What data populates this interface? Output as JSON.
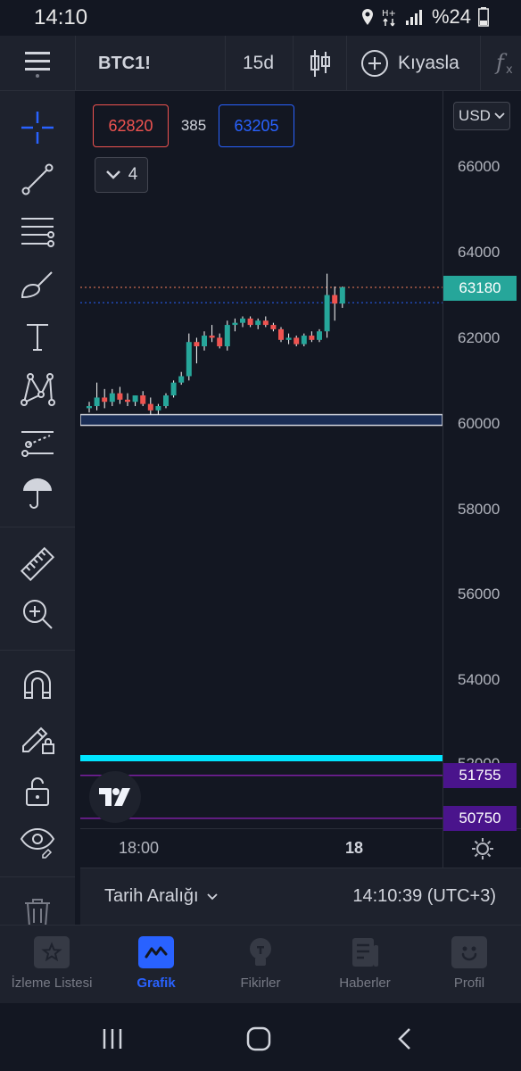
{
  "status_bar": {
    "time": "14:10",
    "battery": "%24"
  },
  "toolbar": {
    "symbol": "BTC1!",
    "interval": "15d",
    "compare_label": "Kıyasla"
  },
  "left_tools": [
    {
      "name": "crosshair-icon"
    },
    {
      "name": "trend-line-icon"
    },
    {
      "name": "fib-retracement-icon"
    },
    {
      "name": "brush-icon"
    },
    {
      "name": "text-tool-icon"
    },
    {
      "name": "pattern-icon"
    },
    {
      "name": "prediction-icon"
    },
    {
      "name": "long-position-icon"
    },
    {
      "name": "ruler-icon"
    },
    {
      "name": "zoom-in-icon"
    },
    {
      "name": "magnet-icon"
    },
    {
      "name": "lock-drawing-icon"
    },
    {
      "name": "unlock-icon"
    },
    {
      "name": "eye-icon"
    },
    {
      "name": "trash-icon"
    }
  ],
  "legend": {
    "bid": "62820",
    "spread": "385",
    "ask": "63205",
    "indicator_count": "4"
  },
  "price_axis": {
    "currency": "USD",
    "labels": [
      "66000",
      "64000",
      "62000",
      "60000",
      "58000",
      "56000",
      "54000",
      "52000"
    ],
    "last_price": "63180",
    "level_1": "51755",
    "level_2": "50750"
  },
  "time_axis": {
    "labels": [
      "18:00",
      "18"
    ]
  },
  "colors": {
    "up": "#26a69a",
    "down": "#ef5350",
    "accent": "#2962ff",
    "cyan_line": "#00e5ff",
    "purple_line": "#7b1fa2"
  },
  "chart_data": {
    "type": "candlestick",
    "ylim": [
      50500,
      67500
    ],
    "candles": [
      {
        "o": 60350,
        "h": 60500,
        "l": 60250,
        "c": 60400
      },
      {
        "o": 60400,
        "h": 60950,
        "l": 60300,
        "c": 60600
      },
      {
        "o": 60600,
        "h": 60800,
        "l": 60350,
        "c": 60500
      },
      {
        "o": 60500,
        "h": 60800,
        "l": 60400,
        "c": 60700
      },
      {
        "o": 60700,
        "h": 60850,
        "l": 60450,
        "c": 60550
      },
      {
        "o": 60550,
        "h": 60700,
        "l": 60400,
        "c": 60500
      },
      {
        "o": 60500,
        "h": 60650,
        "l": 60400,
        "c": 60650
      },
      {
        "o": 60650,
        "h": 60750,
        "l": 60400,
        "c": 60450
      },
      {
        "o": 60450,
        "h": 60600,
        "l": 60200,
        "c": 60300
      },
      {
        "o": 60300,
        "h": 60450,
        "l": 60200,
        "c": 60400
      },
      {
        "o": 60400,
        "h": 60700,
        "l": 60350,
        "c": 60650
      },
      {
        "o": 60650,
        "h": 61000,
        "l": 60600,
        "c": 60950
      },
      {
        "o": 60950,
        "h": 61200,
        "l": 60900,
        "c": 61100
      },
      {
        "o": 61100,
        "h": 62100,
        "l": 61000,
        "c": 61900
      },
      {
        "o": 61900,
        "h": 62000,
        "l": 61400,
        "c": 61800
      },
      {
        "o": 61800,
        "h": 62150,
        "l": 61700,
        "c": 62050
      },
      {
        "o": 62050,
        "h": 62300,
        "l": 61900,
        "c": 62000
      },
      {
        "o": 62000,
        "h": 62100,
        "l": 61750,
        "c": 61800
      },
      {
        "o": 61800,
        "h": 62400,
        "l": 61700,
        "c": 62300
      },
      {
        "o": 62300,
        "h": 62450,
        "l": 62150,
        "c": 62350
      },
      {
        "o": 62350,
        "h": 62500,
        "l": 62250,
        "c": 62450
      },
      {
        "o": 62450,
        "h": 62500,
        "l": 62250,
        "c": 62300
      },
      {
        "o": 62300,
        "h": 62450,
        "l": 62200,
        "c": 62400
      },
      {
        "o": 62400,
        "h": 62500,
        "l": 62250,
        "c": 62300
      },
      {
        "o": 62300,
        "h": 62350,
        "l": 62150,
        "c": 62200
      },
      {
        "o": 62200,
        "h": 62250,
        "l": 61900,
        "c": 61950
      },
      {
        "o": 61950,
        "h": 62100,
        "l": 61850,
        "c": 62000
      },
      {
        "o": 62000,
        "h": 62050,
        "l": 61800,
        "c": 61850
      },
      {
        "o": 61850,
        "h": 62100,
        "l": 61800,
        "c": 62050
      },
      {
        "o": 62050,
        "h": 62150,
        "l": 61900,
        "c": 61950
      },
      {
        "o": 61950,
        "h": 62200,
        "l": 61900,
        "c": 62150
      },
      {
        "o": 62150,
        "h": 63500,
        "l": 62000,
        "c": 63000
      },
      {
        "o": 63000,
        "h": 63200,
        "l": 62400,
        "c": 62800
      },
      {
        "o": 62800,
        "h": 63200,
        "l": 62700,
        "c": 63180
      }
    ],
    "horizontal_lines": [
      {
        "value": 60200,
        "to": 59950,
        "style": "band"
      },
      {
        "value": 63180,
        "style": "dotted-orange"
      },
      {
        "value": 62820,
        "style": "dotted-blue"
      },
      {
        "value": 51900,
        "style": "cyan"
      },
      {
        "value": 51755,
        "style": "purple"
      },
      {
        "value": 50750,
        "style": "purple"
      }
    ]
  },
  "info_bar": {
    "date_range_label": "Tarih Aralığı",
    "clock": "14:10:39 (UTC+3)"
  },
  "bottom_nav": [
    {
      "label": "İzleme Listesi",
      "icon": "star-icon",
      "active": false
    },
    {
      "label": "Grafik",
      "icon": "chart-icon",
      "active": true
    },
    {
      "label": "Fikirler",
      "icon": "bulb-icon",
      "active": false
    },
    {
      "label": "Haberler",
      "icon": "news-icon",
      "active": false
    },
    {
      "label": "Profil",
      "icon": "smiley-icon",
      "active": false
    }
  ]
}
